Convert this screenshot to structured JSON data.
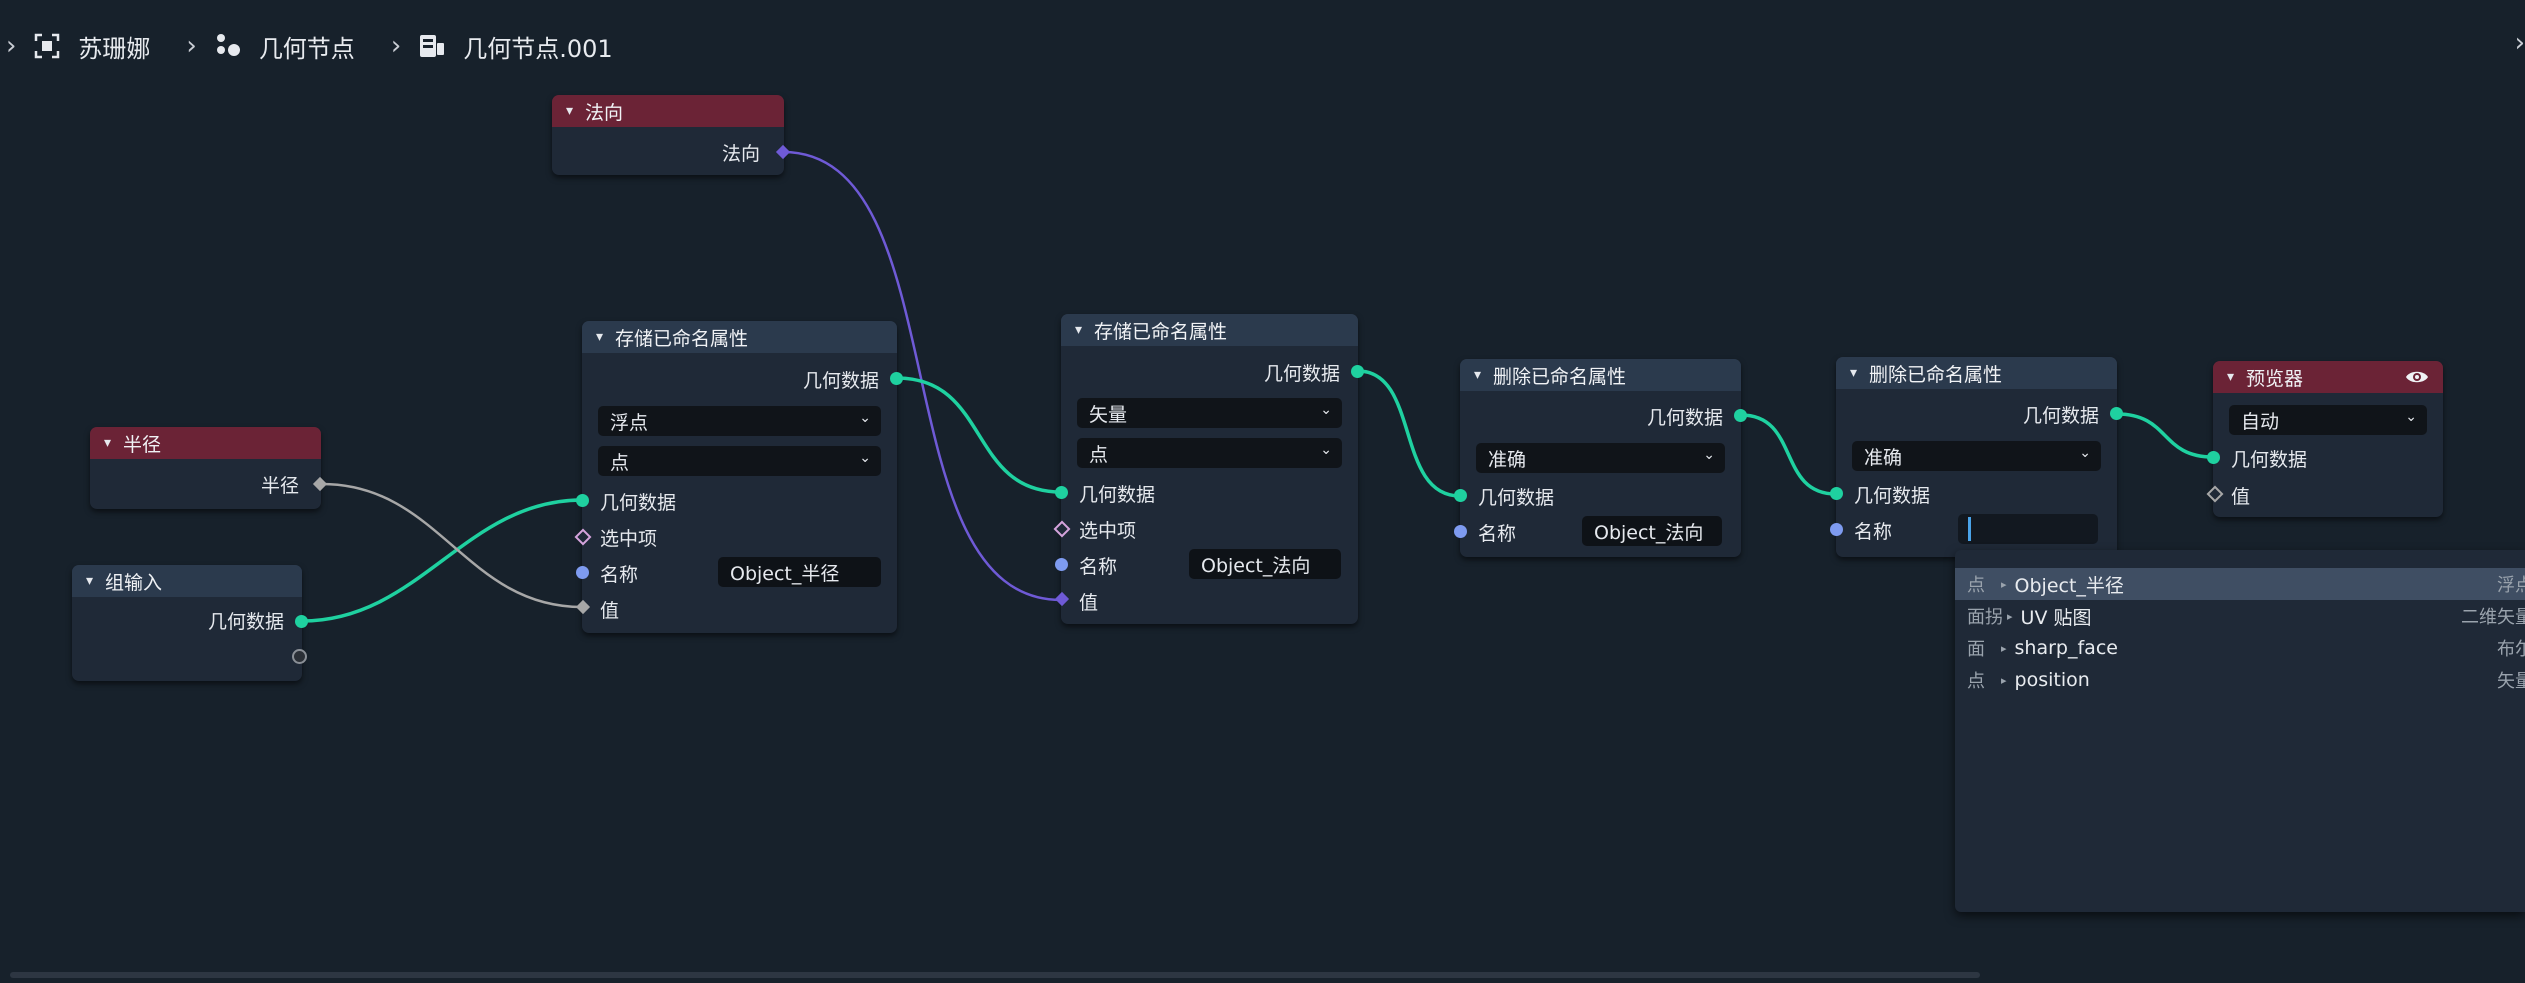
{
  "breadcrumb": {
    "object": "苏珊娜",
    "modifier": "几何节点",
    "node_group": "几何节点.001",
    "icons": [
      "object-frame-icon",
      "geometry-nodes-modifier-icon",
      "node-tree-icon"
    ]
  },
  "nodes": {
    "normal": {
      "title": "法向",
      "out": "法向"
    },
    "radius": {
      "title": "半径",
      "out": "半径"
    },
    "group_input": {
      "title": "组输入",
      "out": "几何数据"
    },
    "store1": {
      "title": "存储已命名属性",
      "out": "几何数据",
      "type": "浮点",
      "domain": "点",
      "in_geo": "几何数据",
      "in_sel": "选中项",
      "in_name": "名称",
      "name_value": "Object_半径",
      "in_value": "值"
    },
    "store2": {
      "title": "存储已命名属性",
      "out": "几何数据",
      "type": "矢量",
      "domain": "点",
      "in_geo": "几何数据",
      "in_sel": "选中项",
      "in_name": "名称",
      "name_value": "Object_法向",
      "in_value": "值"
    },
    "remove1": {
      "title": "删除已命名属性",
      "out": "几何数据",
      "mode": "准确",
      "in_geo": "几何数据",
      "in_name": "名称",
      "name_value": "Object_法向"
    },
    "remove2": {
      "title": "删除已命名属性",
      "out": "几何数据",
      "mode": "准确",
      "in_geo": "几何数据",
      "in_name": "名称",
      "name_value": ""
    },
    "viewer": {
      "title": "预览器",
      "mode": "自动",
      "in_geo": "几何数据",
      "in_value": "值"
    }
  },
  "attribute_search": {
    "items": [
      {
        "domain": "点",
        "name": "Object_半径",
        "type": "浮点",
        "highlighted": true
      },
      {
        "domain": "面拐",
        "name": "UV 贴图",
        "type": "二维矢量",
        "highlighted": false
      },
      {
        "domain": "面",
        "name": "sharp_face",
        "type": "布尔",
        "highlighted": false
      },
      {
        "domain": "点",
        "name": "position",
        "type": "矢量",
        "highlighted": false
      }
    ]
  },
  "colors": {
    "background": "#17212b",
    "node_body": "#1f2937",
    "input_header": "#6b2336",
    "attribute_header": "#2b3a4d",
    "geometry_socket": "#1fd1a0",
    "vector_socket": "#6f5ad6",
    "string_socket": "#7e9bf0",
    "float_socket": "#a7a7a7"
  }
}
